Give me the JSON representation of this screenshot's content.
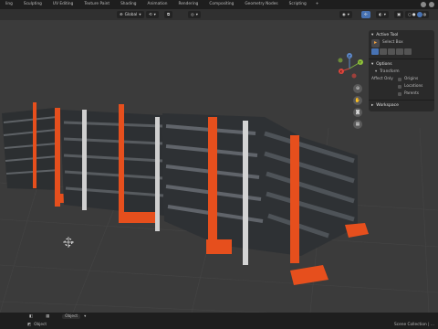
{
  "topbar": {
    "tabs": [
      "ling",
      "Sculpting",
      "UV Editing",
      "Texture Paint",
      "Shading",
      "Animation",
      "Rendering",
      "Compositing",
      "Geometry Nodes",
      "Scripting"
    ],
    "plus": "+"
  },
  "header": {
    "orientation": "Global",
    "options_tooltip": "Options"
  },
  "npanel": {
    "active_tool": {
      "title": "Active Tool",
      "tool_label": "Select Box"
    },
    "options": {
      "title": "Options",
      "transform_title": "Transform",
      "affect_only_label": "Affect Only",
      "items": [
        "Origins",
        "Locations",
        "Parents"
      ]
    },
    "workspace": {
      "title": "Workspace"
    }
  },
  "gizmo": {
    "z": "Z",
    "y": "Y",
    "x": "X"
  },
  "status": {
    "mode": "Object",
    "bottom_left": "Object",
    "collection": "Scene Collection | ..."
  },
  "colors": {
    "accent": "#4772b3",
    "orange": "#e8501c",
    "viewport_bg": "#3b3b3b"
  }
}
